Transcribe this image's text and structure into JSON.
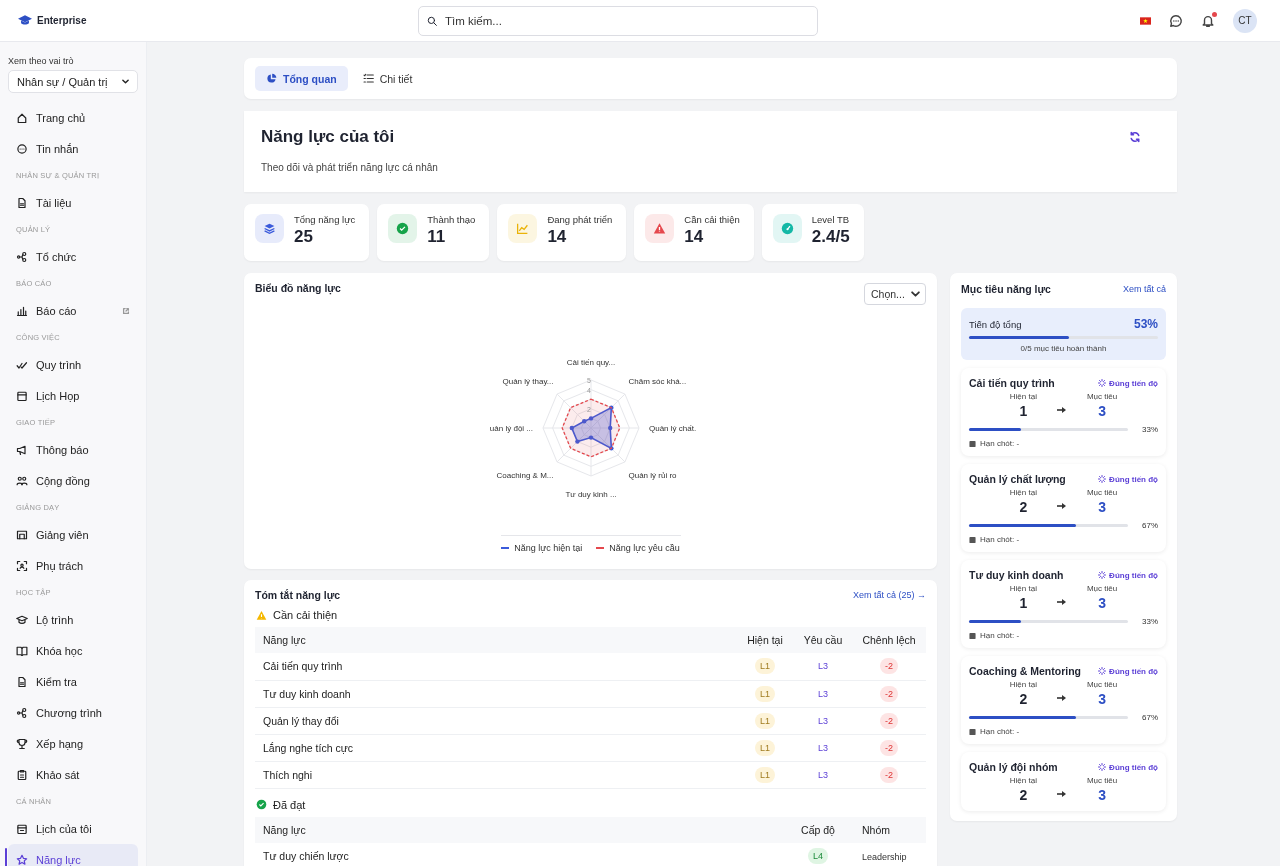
{
  "topbar": {
    "brand": "Enterprise",
    "search": {
      "placeholder": "Tìm kiếm..."
    },
    "avatar": "CT",
    "notifications_unread": true
  },
  "sidebar": {
    "role_label": "Xem theo vai trò",
    "role_select": "Nhân sự / Quản trị",
    "sections": [
      {
        "items": [
          {
            "label": "Trang chủ",
            "selected": false
          },
          {
            "label": "Tin nhắn",
            "selected": false
          }
        ]
      },
      {
        "header": "NHÂN SỰ & QUẢN TRỊ",
        "items": [
          {
            "label": "Tài liệu",
            "selected": false
          }
        ]
      },
      {
        "header": "QUẢN LÝ",
        "items": [
          {
            "label": "Tổ chức",
            "selected": false
          }
        ]
      },
      {
        "header": "BÁO CÁO",
        "items": [
          {
            "label": "Báo cáo",
            "selected": false,
            "external": true
          }
        ]
      },
      {
        "header": "CÔNG VIỆC",
        "items": [
          {
            "label": "Quy trình",
            "selected": false
          },
          {
            "label": "Lịch Họp",
            "selected": false
          }
        ]
      },
      {
        "header": "GIAO TIẾP",
        "items": [
          {
            "label": "Thông báo",
            "selected": false
          },
          {
            "label": "Cộng đồng",
            "selected": false
          }
        ]
      },
      {
        "header": "GIẢNG DẠY",
        "items": [
          {
            "label": "Giảng viên",
            "selected": false
          },
          {
            "label": "Phụ trách",
            "selected": false
          }
        ]
      },
      {
        "header": "HỌC TẬP",
        "items": [
          {
            "label": "Lộ trình",
            "selected": false
          },
          {
            "label": "Khóa học",
            "selected": false
          },
          {
            "label": "Kiểm tra",
            "selected": false
          },
          {
            "label": "Chương trình",
            "selected": false
          },
          {
            "label": "Xếp hạng",
            "selected": false
          },
          {
            "label": "Khảo sát",
            "selected": false
          }
        ]
      },
      {
        "header": "CÁ NHÂN",
        "items": [
          {
            "label": "Lịch của tôi",
            "selected": false
          },
          {
            "label": "Năng lực",
            "selected": true
          }
        ]
      }
    ]
  },
  "tabs": [
    {
      "label": "Tổng quan",
      "selected": true
    },
    {
      "label": "Chi tiết",
      "selected": false
    }
  ],
  "header": {
    "title": "Năng lực của tôi",
    "subtitle": "Theo dõi và phát triển năng lực cá nhân"
  },
  "stats": [
    {
      "label": "Tổng năng lực",
      "value": "25",
      "color": "#3b5bdb"
    },
    {
      "label": "Thành thạo",
      "value": "11",
      "color": "#16a34a"
    },
    {
      "label": "Đang phát triển",
      "value": "14",
      "color": "#eab308"
    },
    {
      "label": "Cần cải thiện",
      "value": "14",
      "color": "#e5484d"
    },
    {
      "label": "Level TB",
      "value": "2.4/5",
      "color": "#14b8a6"
    }
  ],
  "chart_card": {
    "title": "Biểu đồ năng lực",
    "select": "Chọn...",
    "radar": {
      "axes": [
        "Cải tiến quy...",
        "Quản lý thay...",
        "Chăm sóc khá...",
        "uản lý đội ...",
        "Quản lý chất.",
        "Coaching & M...",
        "Quản lý rủi ro",
        "Tư duy kinh ..."
      ],
      "ticks": [
        "5",
        "4",
        "2"
      ],
      "legend": [
        {
          "name": "Năng lực hiện tại",
          "color": "#3b5bdb"
        },
        {
          "name": "Năng lực yêu cầu",
          "color": "#e5484d"
        }
      ]
    }
  },
  "summary": {
    "title": "Tóm tắt năng lực",
    "link": "Xem tất cả (25) →",
    "improve": {
      "heading": "Cần cải thiện",
      "columns": [
        "Năng lực",
        "Hiện tại",
        "Yêu cầu",
        "Chênh lệch"
      ],
      "rows": [
        {
          "name": "Cải tiến quy trình",
          "current": "L1",
          "required": "L3",
          "gap": "-2"
        },
        {
          "name": "Tư duy kinh doanh",
          "current": "L1",
          "required": "L3",
          "gap": "-2"
        },
        {
          "name": "Quản lý thay đổi",
          "current": "L1",
          "required": "L3",
          "gap": "-2"
        },
        {
          "name": "Lắng nghe tích cực",
          "current": "L1",
          "required": "L3",
          "gap": "-2"
        },
        {
          "name": "Thích nghi",
          "current": "L1",
          "required": "L3",
          "gap": "-2"
        }
      ]
    },
    "achieved": {
      "heading": "Đã đạt",
      "columns": [
        "Năng lực",
        "Cấp độ",
        "Nhóm"
      ],
      "rows": [
        {
          "name": "Tư duy chiến lược",
          "level": "L4",
          "group": "Leadership"
        }
      ]
    }
  },
  "goals": {
    "title": "Mục tiêu năng lực",
    "link": "Xem tất cả",
    "overall": {
      "label": "Tiến độ tổng",
      "percent": "53%",
      "level": 0.53,
      "note": "0/5 mục tiêu hoàn thành"
    },
    "items": [
      {
        "name": "Cải tiến quy trình",
        "status": "Đúng tiến độ",
        "current_label": "Hiện tại",
        "current": "1",
        "target_label": "Mục tiêu",
        "target": "3",
        "level": 0.33,
        "percent": "33%",
        "deadline": "Hạn chót: -"
      },
      {
        "name": "Quản lý chất lượng",
        "status": "Đúng tiến độ",
        "current_label": "Hiện tại",
        "current": "2",
        "target_label": "Mục tiêu",
        "target": "3",
        "level": 0.67,
        "percent": "67%",
        "deadline": "Hạn chót: -"
      },
      {
        "name": "Tư duy kinh doanh",
        "status": "Đúng tiến độ",
        "current_label": "Hiện tại",
        "current": "1",
        "target_label": "Mục tiêu",
        "target": "3",
        "level": 0.33,
        "percent": "33%",
        "deadline": "Hạn chót: -"
      },
      {
        "name": "Coaching & Mentoring",
        "status": "Đúng tiến độ",
        "current_label": "Hiện tại",
        "current": "2",
        "target_label": "Mục tiêu",
        "target": "3",
        "level": 0.67,
        "percent": "67%",
        "deadline": "Hạn chót: -"
      },
      {
        "name": "Quản lý đội nhóm",
        "status": "Đúng tiến độ",
        "current_label": "Hiện tại",
        "current": "2",
        "target_label": "Mục tiêu",
        "target": "3"
      }
    ]
  }
}
